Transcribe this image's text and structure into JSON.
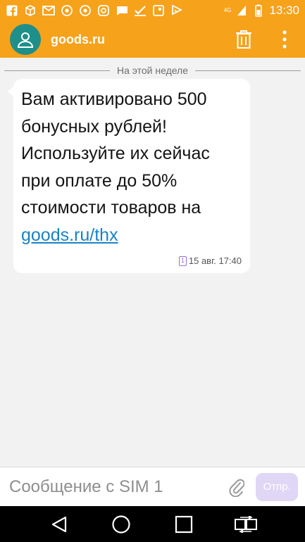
{
  "status_bar": {
    "time": "13:30",
    "network": "4G",
    "icons": [
      "facebook-icon",
      "box-icon",
      "gmail-icon",
      "chrome-icon",
      "chrome-icon",
      "instagram-icon",
      "message-icon",
      "checkmark-icon",
      "maps-icon",
      "flag-icon"
    ],
    "accent": "#f7a21b"
  },
  "header": {
    "contact": "goods.ru",
    "avatar_color": "#1f8f8a"
  },
  "conversation": {
    "date_divider": "На этой неделе",
    "message": {
      "text": "Вам активировано 500 бонусных рублей! Используйте их сейчас при оплате до 50% стоимости товаров на ",
      "link": "goods.ru/thx",
      "sim": "1",
      "timestamp": "15 авг. 17:40"
    }
  },
  "compose": {
    "placeholder": "Сообщение с SIM 1",
    "send_label": "Отпр."
  }
}
